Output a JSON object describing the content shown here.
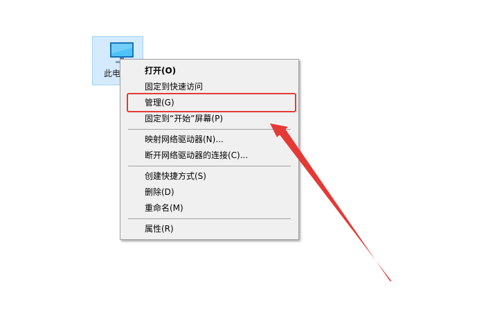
{
  "desktop": {
    "icon": {
      "label": "此电脑",
      "icon_name": "computer-icon"
    }
  },
  "context_menu": {
    "groups": [
      {
        "items": [
          {
            "label": "打开(O)",
            "bold": true
          },
          {
            "label": "固定到快速访问",
            "bold": false
          },
          {
            "label": "管理(G)",
            "bold": false,
            "highlighted": true
          },
          {
            "label": "固定到“开始”屏幕(P)",
            "bold": false
          }
        ]
      },
      {
        "items": [
          {
            "label": "映射网络驱动器(N)...",
            "bold": false
          },
          {
            "label": "断开网络驱动器的连接(C)...",
            "bold": false
          }
        ]
      },
      {
        "items": [
          {
            "label": "创建快捷方式(S)",
            "bold": false
          },
          {
            "label": "删除(D)",
            "bold": false
          },
          {
            "label": "重命名(M)",
            "bold": false
          }
        ]
      },
      {
        "items": [
          {
            "label": "属性(R)",
            "bold": false
          }
        ]
      }
    ]
  },
  "annotation": {
    "highlight_color": "#e53935",
    "arrow_color": "#e53935"
  }
}
